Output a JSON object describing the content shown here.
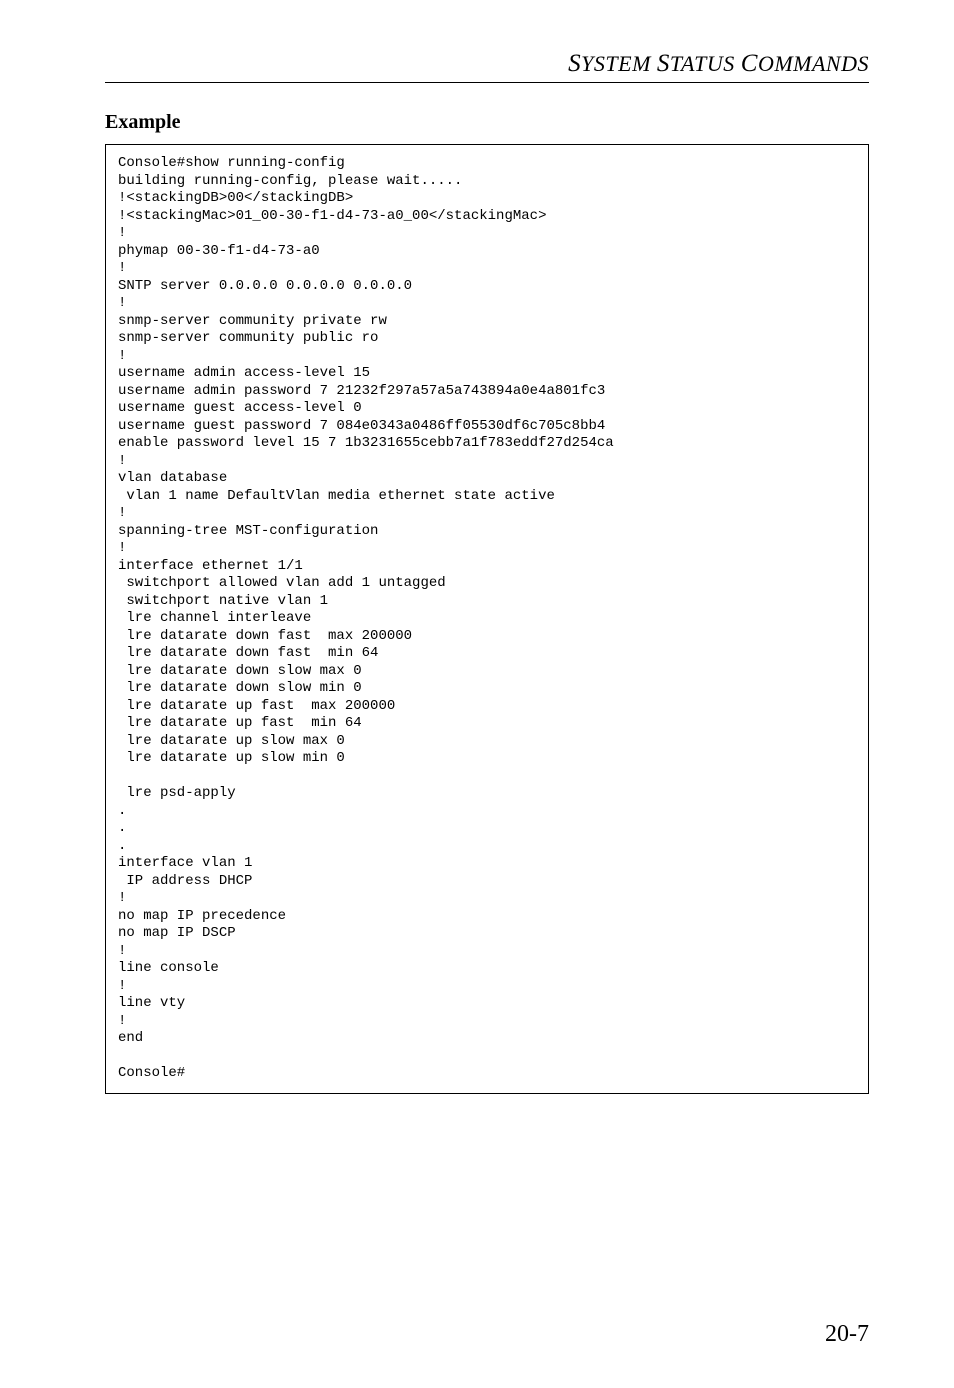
{
  "header": {
    "title_html": "SYSTEM STATUS COMMANDS"
  },
  "section": {
    "title": "Example"
  },
  "code": "Console#show running-config\nbuilding running-config, please wait.....\n!<stackingDB>00</stackingDB>\n!<stackingMac>01_00-30-f1-d4-73-a0_00</stackingMac>\n!\nphymap 00-30-f1-d4-73-a0\n!\nSNTP server 0.0.0.0 0.0.0.0 0.0.0.0\n!\nsnmp-server community private rw\nsnmp-server community public ro\n!\nusername admin access-level 15\nusername admin password 7 21232f297a57a5a743894a0e4a801fc3\nusername guest access-level 0\nusername guest password 7 084e0343a0486ff05530df6c705c8bb4\nenable password level 15 7 1b3231655cebb7a1f783eddf27d254ca\n!\nvlan database\n vlan 1 name DefaultVlan media ethernet state active\n!\nspanning-tree MST-configuration\n!\ninterface ethernet 1/1\n switchport allowed vlan add 1 untagged\n switchport native vlan 1\n lre channel interleave\n lre datarate down fast  max 200000\n lre datarate down fast  min 64\n lre datarate down slow max 0\n lre datarate down slow min 0\n lre datarate up fast  max 200000\n lre datarate up fast  min 64\n lre datarate up slow max 0\n lre datarate up slow min 0\n\n lre psd-apply\n.\n.\n.\ninterface vlan 1\n IP address DHCP\n!\nno map IP precedence\nno map IP DSCP\n!\nline console\n!\nline vty\n!\nend\n\nConsole#",
  "page_number": "20-7"
}
